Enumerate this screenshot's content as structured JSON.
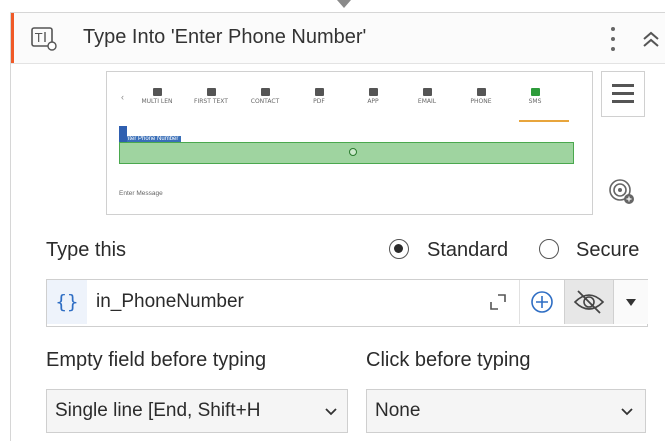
{
  "activity": {
    "title": "Type Into 'Enter Phone Number'",
    "accent_color": "#f05a28",
    "icon": "type-into-icon"
  },
  "preview": {
    "nav_items": [
      {
        "label": "MULTI LEN",
        "icon": "list-icon"
      },
      {
        "label": "FIRST TEXT",
        "icon": "document-icon"
      },
      {
        "label": "CONTACT",
        "icon": "contact-icon"
      },
      {
        "label": "PDF",
        "icon": "pdf-icon"
      },
      {
        "label": "APP",
        "icon": "grid-icon"
      },
      {
        "label": "EMAIL",
        "icon": "mail-icon"
      },
      {
        "label": "PHONE",
        "icon": "phone-icon"
      },
      {
        "label": "SMS",
        "icon": "sms-icon",
        "active": true
      }
    ],
    "field_label": "Enter Phone Number",
    "footer_text": "Enter Message"
  },
  "type_this": {
    "label": "Type this",
    "options": [
      {
        "label": "Standard",
        "selected": true
      },
      {
        "label": "Secure",
        "selected": false
      }
    ],
    "value": "in_PhoneNumber",
    "var_icon_text": "{}"
  },
  "empty_field": {
    "label": "Empty field before typing",
    "value": "Single line [End, Shift+H"
  },
  "click_before": {
    "label": "Click before typing",
    "value": "None"
  }
}
